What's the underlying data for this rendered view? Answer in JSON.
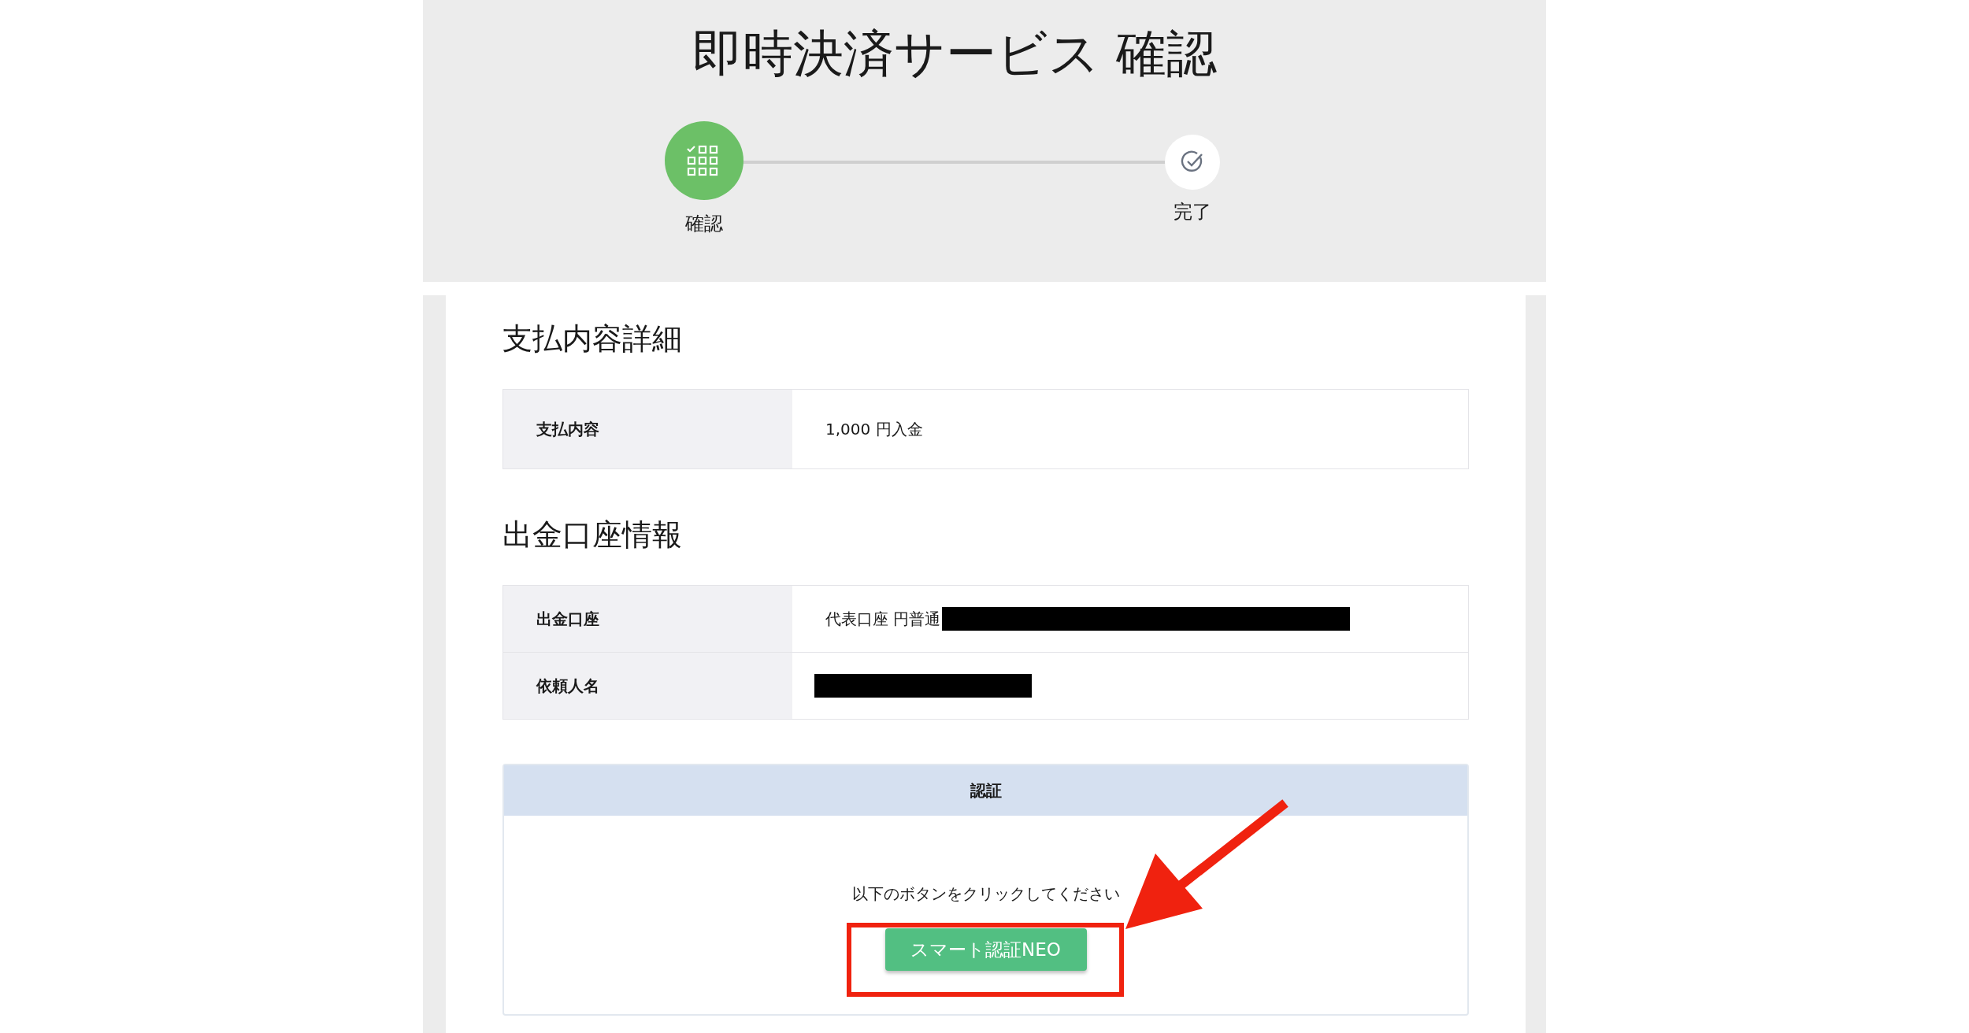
{
  "title": "即時決済サービス 確認",
  "steps": [
    {
      "label": "確認",
      "kind": "grid",
      "selected": true
    },
    {
      "label": "完了",
      "kind": "check",
      "selected": false
    }
  ],
  "sections": [
    {
      "heading": "支払内容詳細",
      "rows": [
        {
          "label": "支払内容",
          "value": "1,000 円入金"
        }
      ]
    },
    {
      "heading": "出金口座情報",
      "rows": [
        {
          "label": "出金口座",
          "value": "代表口座 円普通",
          "redacted": true
        },
        {
          "label": "依頼人名",
          "redacted": true
        }
      ]
    }
  ],
  "auth": {
    "header": "認証",
    "instruction": "以下のボタンをクリックしてください",
    "button": "スマート認証NEO"
  },
  "annotation": {
    "highlight": true
  }
}
